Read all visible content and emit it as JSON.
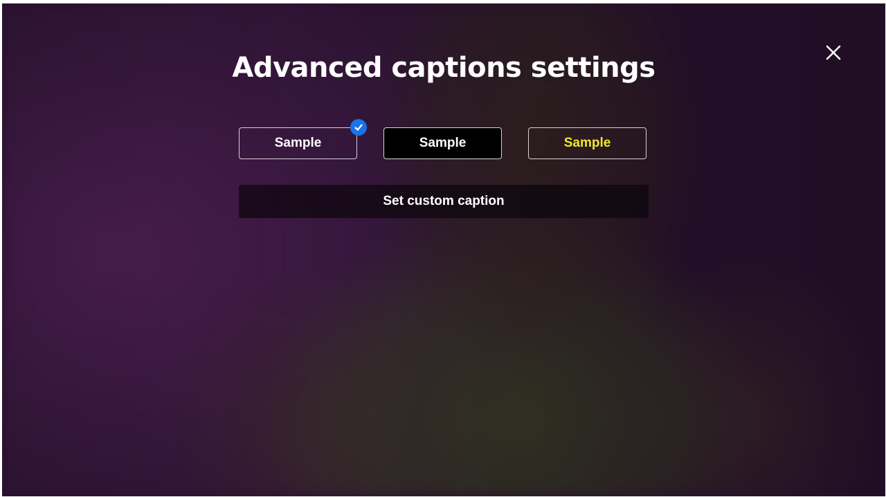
{
  "dialog": {
    "title": "Advanced captions settings"
  },
  "caption_styles": [
    {
      "label": "Sample",
      "selected": true,
      "background": "transparent",
      "text_color": "#ffffff"
    },
    {
      "label": "Sample",
      "selected": false,
      "background": "#000000",
      "text_color": "#ffffff"
    },
    {
      "label": "Sample",
      "selected": false,
      "background": "transparent",
      "text_color": "#f2e62a"
    }
  ],
  "custom_caption": {
    "label": "Set custom caption"
  },
  "icons": {
    "close": "close-icon",
    "selected": "checkmark-icon"
  },
  "colors": {
    "accent": "#1a73e8",
    "yellow_text": "#f2e62a",
    "backdrop": "#2a1230"
  }
}
